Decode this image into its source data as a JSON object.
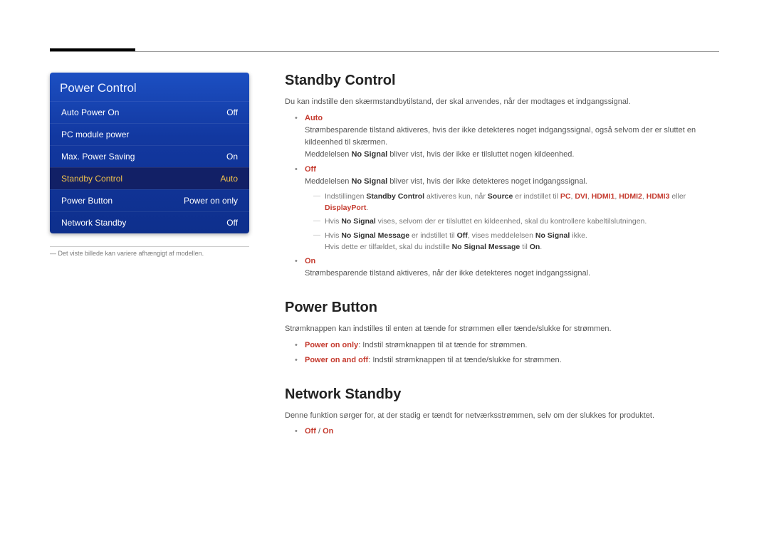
{
  "menu": {
    "title": "Power Control",
    "rows": [
      {
        "label": "Auto Power On",
        "value": "Off"
      },
      {
        "label": "PC module power",
        "value": ""
      },
      {
        "label": "Max. Power Saving",
        "value": "On"
      },
      {
        "label": "Standby Control",
        "value": "Auto"
      },
      {
        "label": "Power Button",
        "value": "Power on only"
      },
      {
        "label": "Network Standby",
        "value": "Off"
      }
    ],
    "footnote": "― Det viste billede kan variere afhængigt af modellen."
  },
  "sc": {
    "h": "Standby Control",
    "intro": "Du kan indstille den skærmstandbytilstand, der skal anvendes, når der modtages et indgangssignal.",
    "auto_label": "Auto",
    "auto_p1a": "Strømbesparende tilstand aktiveres, hvis der ikke detekteres noget indgangssignal, også selvom der er sluttet en kildeenhed til skærmen.",
    "auto_p2a": "Meddelelsen ",
    "auto_p2b": "No Signal",
    "auto_p2c": " bliver vist, hvis der ikke er tilsluttet nogen kildeenhed.",
    "off_label": "Off",
    "off_p1a": "Meddelelsen ",
    "off_p1b": "No Signal",
    "off_p1c": " bliver vist, hvis der ikke detekteres noget indgangssignal.",
    "off_s1a": "Indstillingen ",
    "off_s1b": "Standby Control",
    "off_s1c": " aktiveres kun, når ",
    "off_s1d": "Source",
    "off_s1e": " er indstillet til ",
    "off_s1_pc": "PC",
    "off_s1_dvi": "DVI",
    "off_s1_h1": "HDMI1",
    "off_s1_h2": "HDMI2",
    "off_s1_h3": "HDMI3",
    "off_s1_or": " eller ",
    "off_s1_dp": "DisplayPort",
    "off_s1_end": ".",
    "off_s2a": "Hvis ",
    "off_s2b": "No Signal",
    "off_s2c": " vises, selvom der er tilsluttet en kildeenhed, skal du kontrollere kabeltilslutningen.",
    "off_s3a": "Hvis ",
    "off_s3b": "No Signal Message",
    "off_s3c": " er indstillet til ",
    "off_s3d": "Off",
    "off_s3e": ", vises meddelelsen ",
    "off_s3f": "No Signal",
    "off_s3g": " ikke.",
    "off_s3_2a": "Hvis dette er tilfældet, skal du indstille ",
    "off_s3_2b": "No Signal Message",
    "off_s3_2c": " til ",
    "off_s3_2d": "On",
    "off_s3_2e": ".",
    "on_label": "On",
    "on_p": "Strømbesparende tilstand aktiveres, når der ikke detekteres noget indgangssignal."
  },
  "pb": {
    "h": "Power Button",
    "intro": "Strømknappen kan indstilles til enten at tænde for strømmen eller tænde/slukke for strømmen.",
    "b1a": "Power on only",
    "b1b": ": Indstil strømknappen til at tænde for strømmen.",
    "b2a": "Power on and off",
    "b2b": ": Indstil strømknappen til at tænde/slukke for strømmen."
  },
  "ns": {
    "h": "Network Standby",
    "intro": "Denne funktion sørger for, at der stadig er tændt for netværksstrømmen, selv om der slukkes for produktet.",
    "opt1": "Off",
    "sep": " / ",
    "opt2": "On"
  }
}
